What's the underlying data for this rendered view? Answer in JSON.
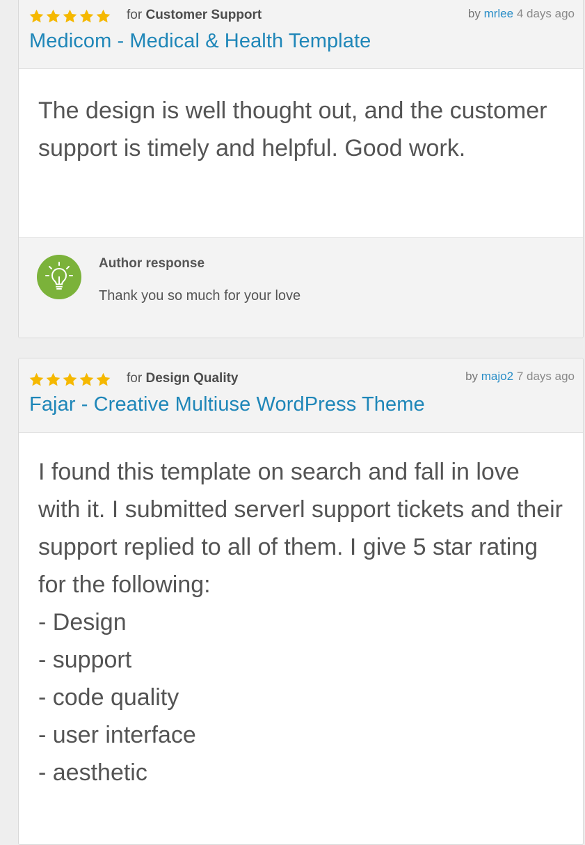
{
  "reviews": [
    {
      "rating": 5,
      "for_prefix": "for",
      "category": "Customer Support",
      "by_prefix": "by",
      "username": "mrlee",
      "time_ago": "4 days ago",
      "item_title": "Medicom - Medical & Health Template",
      "body_text": "The design is well thought out, and the customer support is timely and helpful. Good work.",
      "author_response": {
        "title": "Author response",
        "text": "Thank you so much for your love",
        "icon": "lightbulb-icon"
      }
    },
    {
      "rating": 5,
      "for_prefix": "for",
      "category": "Design Quality",
      "by_prefix": "by",
      "username": "majo2",
      "time_ago": "7 days ago",
      "item_title": "Fajar - Creative Multiuse WordPress Theme",
      "body_text": "I found this template on search and fall in love with it. I submitted serverl support tickets and their support replied to all of them. I give 5 star rating for the following:",
      "body_list": [
        "- Design",
        "- support",
        "- code quality",
        "- user interface",
        "- aesthetic"
      ]
    }
  ],
  "colors": {
    "star": "#f5b800",
    "link": "#1e86b8",
    "username": "#2a8ec7",
    "response_icon_bg": "#7bb23a"
  }
}
